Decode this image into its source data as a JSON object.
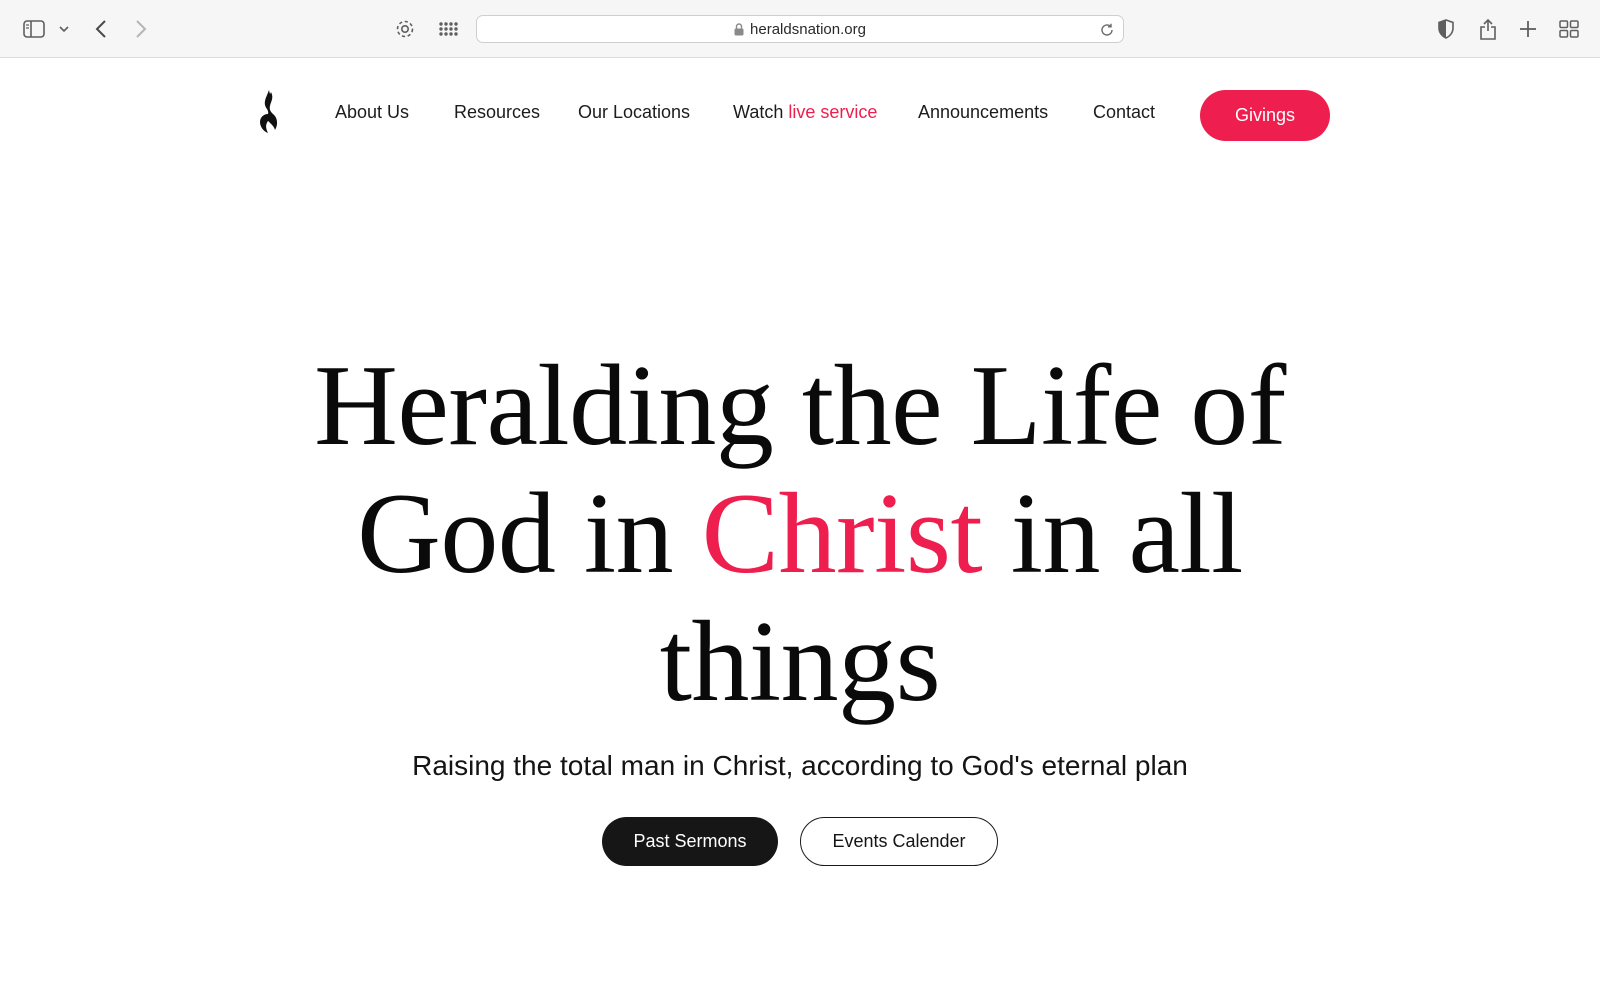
{
  "browser": {
    "url": "heraldsnation.org",
    "icons": [
      "sidebar-icon",
      "chevron-down-icon",
      "back-icon",
      "forward-icon",
      "gear-icon",
      "grid-icon",
      "lock-icon",
      "reload-icon",
      "shield-icon",
      "share-icon",
      "plus-icon",
      "tabs-overview-icon"
    ]
  },
  "nav": {
    "logo": "flame-logo",
    "items": [
      {
        "label": "About Us"
      },
      {
        "label": "Resources"
      },
      {
        "label": "Our Locations"
      },
      {
        "label": "Announcements"
      },
      {
        "label": "Contact"
      }
    ],
    "watch": {
      "label": "Watch",
      "accent": "live service"
    },
    "cta": "Givings"
  },
  "hero": {
    "line1": "Heralding the Life of",
    "line2_pre": "God in ",
    "line2_accent": "Christ",
    "line2_post": " in all",
    "line3": "things",
    "subtitle": "Raising the total man in Christ, according to God's eternal plan",
    "primary_button": "Past Sermons",
    "secondary_button": "Events Calender"
  },
  "colors": {
    "accent": "#ee1f4e",
    "dark_button": "#161616",
    "text": "#0a0a0a"
  }
}
